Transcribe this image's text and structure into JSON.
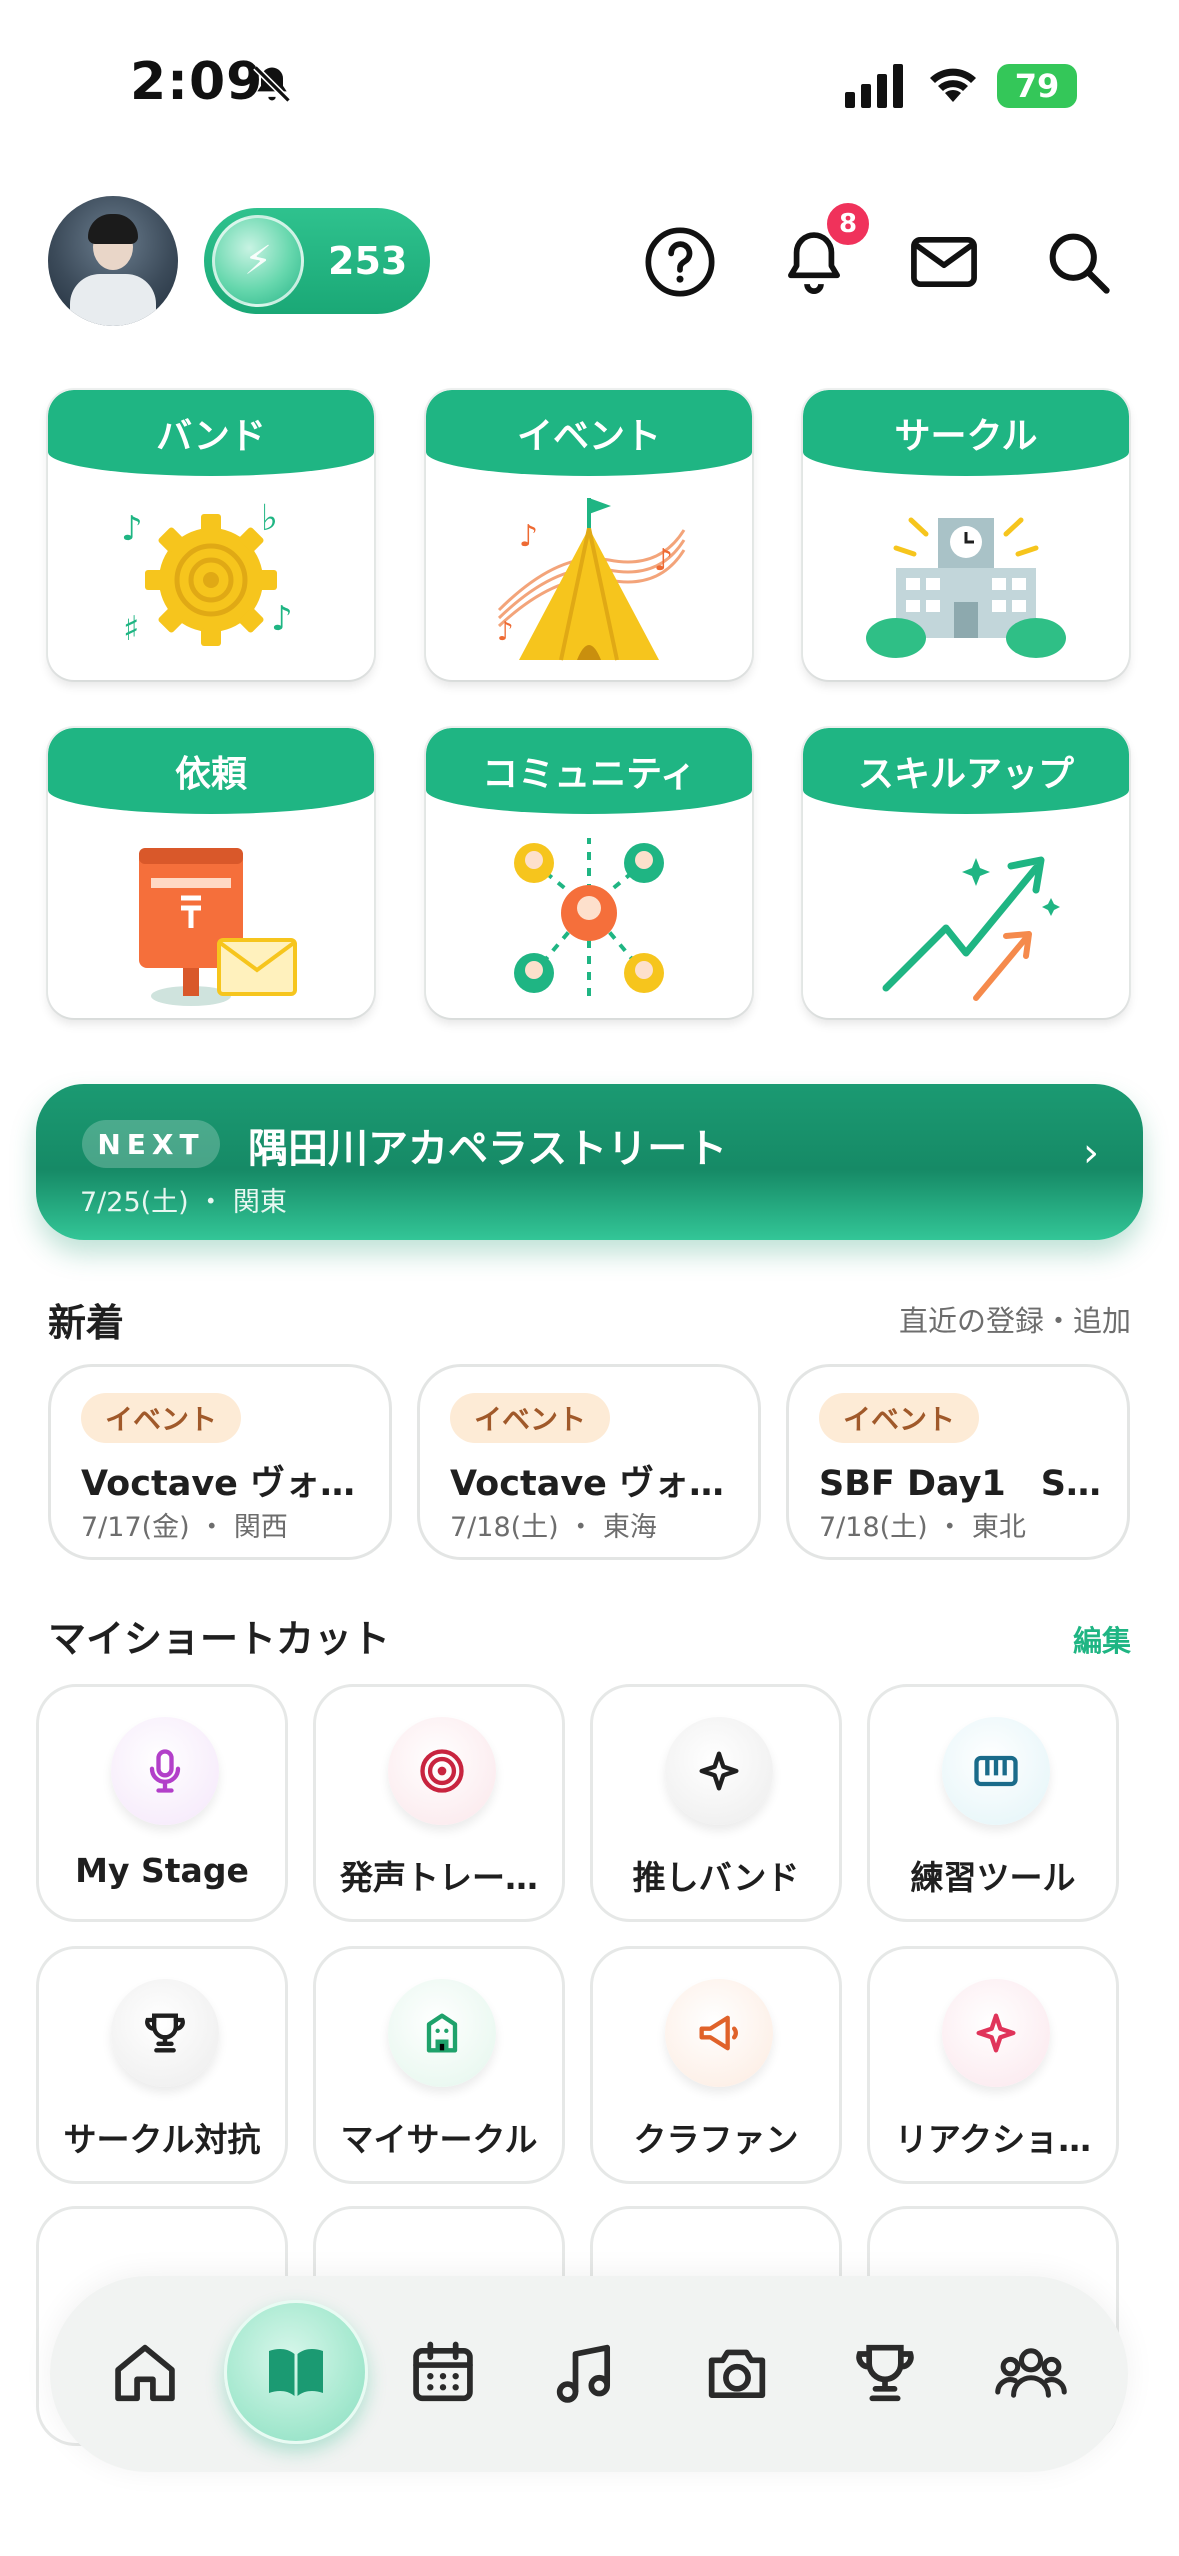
{
  "status_bar": {
    "time": "2:09",
    "battery": "79"
  },
  "header": {
    "coin_count": "253",
    "notification_count": "8"
  },
  "categories": [
    {
      "label": "バンド"
    },
    {
      "label": "イベント"
    },
    {
      "label": "サークル"
    },
    {
      "label": "依頼"
    },
    {
      "label": "コミュニティ"
    },
    {
      "label": "スキルアップ"
    }
  ],
  "next_event": {
    "badge": "NEXT",
    "title": "隅田川アカペラストリート",
    "subtitle": "7/25(土) ・ 関東"
  },
  "new_section": {
    "title": "新着",
    "link": "直近の登録・追加",
    "items": [
      {
        "tag": "イベント",
        "name": "Voctave ヴォ…",
        "meta": "7/17(金) ・ 関西"
      },
      {
        "tag": "イベント",
        "name": "Voctave ヴォ…",
        "meta": "7/18(土) ・ 東海"
      },
      {
        "tag": "イベント",
        "name": "SBF Day1　S…",
        "meta": "7/18(土) ・ 東北"
      }
    ]
  },
  "shortcuts": {
    "title": "マイショートカット",
    "edit": "編集",
    "items": [
      {
        "label": "My Stage",
        "icon": "microphone-icon"
      },
      {
        "label": "発声トレー…",
        "icon": "target-icon"
      },
      {
        "label": "推しバンド",
        "icon": "sparkle-icon"
      },
      {
        "label": "練習ツール",
        "icon": "keyboard-icon"
      },
      {
        "label": "サークル対抗",
        "icon": "trophy-icon"
      },
      {
        "label": "マイサークル",
        "icon": "building-icon"
      },
      {
        "label": "クラファン",
        "icon": "megaphone-icon"
      },
      {
        "label": "リアクショ…",
        "icon": "star-icon"
      }
    ]
  },
  "bottom_nav": [
    "home-icon",
    "book-icon",
    "calendar-icon",
    "music-note-icon",
    "camera-icon",
    "trophy-icon",
    "people-icon"
  ],
  "colors": {
    "accent": "#1fb583",
    "badge": "#f0325b",
    "tag_bg": "#fdebd6"
  }
}
